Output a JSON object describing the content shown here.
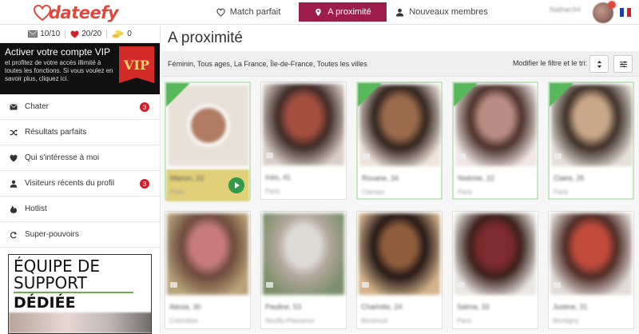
{
  "app": {
    "logo_text": "dateefy",
    "brand_color": "#e0473d",
    "accent_color": "#9c1d4c"
  },
  "nav": [
    {
      "label": "Match parfait",
      "icon": "heart-outline-icon",
      "active": false
    },
    {
      "label": "A proximité",
      "icon": "location-pin-icon",
      "active": true
    },
    {
      "label": "Nouveaux membres",
      "icon": "person-icon",
      "active": false
    }
  ],
  "user": {
    "name": "Nathan94"
  },
  "sidebar": {
    "stats": [
      {
        "icon": "mail-icon",
        "value": "10/10"
      },
      {
        "icon": "heart-icon",
        "value": "20/20"
      },
      {
        "icon": "coins-icon",
        "value": "0"
      }
    ],
    "vip": {
      "title": "Activer votre compte VIP",
      "text": "et profitez de votre accès illimité à toutes les fonctions. Si vous voulez en savoir plus, cliquez ici.",
      "badge": "VIP"
    },
    "menu": [
      {
        "label": "Chater",
        "icon": "envelope-icon",
        "count": "3"
      },
      {
        "label": "Résultats parfaits",
        "icon": "shuffle-icon",
        "count": null
      },
      {
        "label": "Qui s'intéresse à moi",
        "icon": "heart-icon",
        "count": null
      },
      {
        "label": "Visiteurs récents du profil",
        "icon": "person-icon",
        "count": "3"
      },
      {
        "label": "Hotlist",
        "icon": "flame-icon",
        "count": null
      },
      {
        "label": "Super-pouvoirs",
        "icon": "refresh-icon",
        "count": null
      }
    ],
    "support": {
      "line1": "ÉQUIPE DE",
      "line2": "SUPPORT",
      "line3": "DÉDIÉE"
    }
  },
  "main": {
    "title": "A proximité",
    "filter_summary": "Féminin, Tous ages, La France, Île-de-France, Toutes les villes",
    "filter_action": "Modifier le filtre et le tri:"
  },
  "profiles": [
    {
      "name": "Manon, 22",
      "city": "Paris",
      "colors": [
        "#e8e1d8",
        "#b07b62",
        "#5b4035"
      ],
      "badge": true,
      "yellow": true
    },
    {
      "name": "Inès, 41",
      "city": "Paris",
      "colors": [
        "#d9cfc7",
        "#a34e3f",
        "#3d2a25"
      ],
      "badge": false
    },
    {
      "name": "Roxane, 34",
      "city": "Clamart",
      "colors": [
        "#efe4d9",
        "#9b6b4c",
        "#2f221c"
      ],
      "badge": true
    },
    {
      "name": "Noémie, 22",
      "city": "Paris",
      "colors": [
        "#f0e6e3",
        "#b98d83",
        "#4a3029"
      ],
      "badge": true
    },
    {
      "name": "Claire, 25",
      "city": "Paris",
      "colors": [
        "#e5dfd8",
        "#c8a78a",
        "#3c2e25"
      ],
      "badge": true
    },
    {
      "name": "Alexia, 30",
      "city": "Colombes",
      "colors": [
        "#b8a37a",
        "#c77c7a",
        "#6c4a3c"
      ],
      "badge": false
    },
    {
      "name": "Pauline, 53",
      "city": "Neuilly-Plaisance",
      "colors": [
        "#7b8f6a",
        "#dedad6",
        "#b3a79b"
      ],
      "badge": false
    },
    {
      "name": "Charlotte, 24",
      "city": "Montreuil",
      "colors": [
        "#d4b48c",
        "#8f5d3d",
        "#241714"
      ],
      "badge": false
    },
    {
      "name": "Salma, 33",
      "city": "Paris",
      "colors": [
        "#e8e6e2",
        "#7e2a2f",
        "#3b1f19"
      ],
      "badge": false
    },
    {
      "name": "Justine, 31",
      "city": "Montigny",
      "colors": [
        "#e2dcd9",
        "#c24b3c",
        "#4e2b24"
      ],
      "badge": false
    }
  ]
}
